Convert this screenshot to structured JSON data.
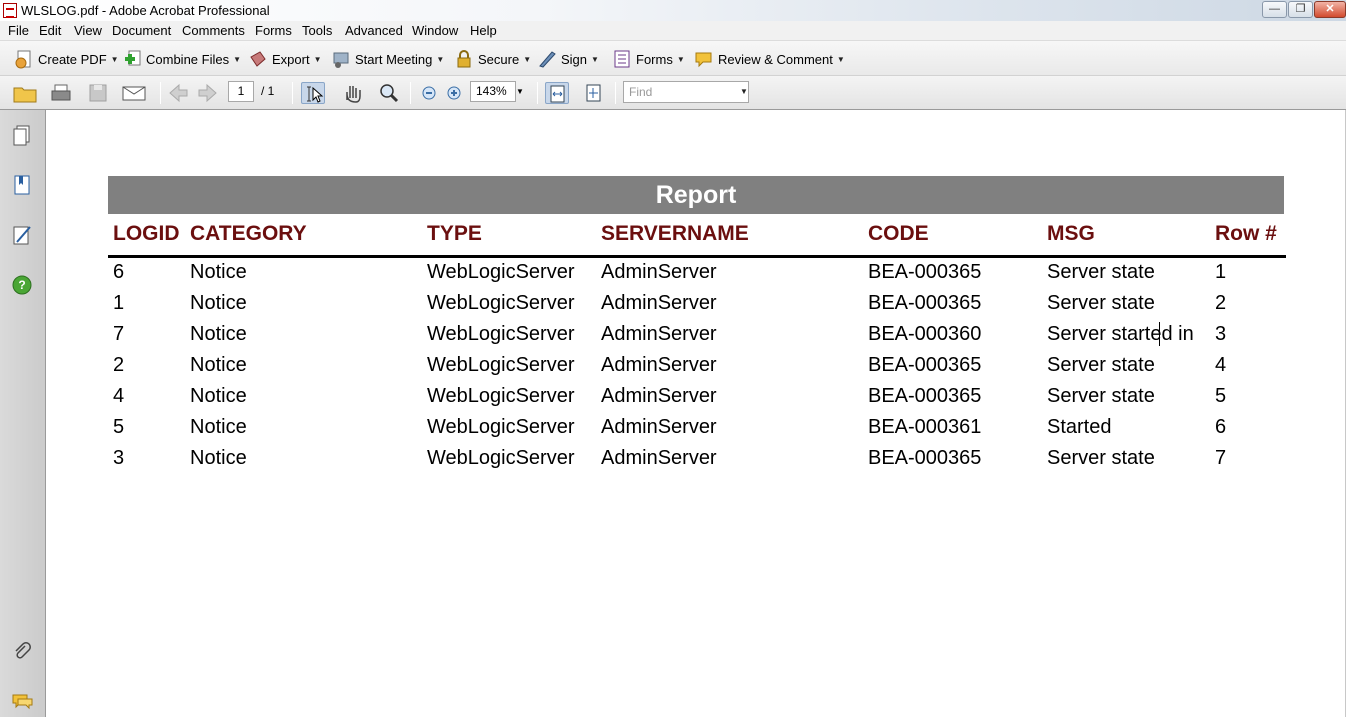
{
  "window": {
    "title": "WLSLOG.pdf - Adobe Acrobat Professional"
  },
  "menu": [
    "File",
    "Edit",
    "View",
    "Document",
    "Comments",
    "Forms",
    "Tools",
    "Advanced",
    "Window",
    "Help"
  ],
  "toolbar": {
    "create_pdf": "Create PDF",
    "combine_files": "Combine Files",
    "export": "Export",
    "start_meeting": "Start Meeting",
    "secure": "Secure",
    "sign": "Sign",
    "forms": "Forms",
    "review_comment": "Review & Comment"
  },
  "nav": {
    "page_current": "1",
    "page_total": "/ 1",
    "zoom": "143%",
    "find_placeholder": "Find"
  },
  "report": {
    "title": "Report",
    "columns": [
      "LOGID",
      "CATEGORY",
      "TYPE",
      "SERVERNAME",
      "CODE",
      "MSG",
      "Row #"
    ],
    "rows": [
      {
        "logid": "6",
        "category": "Notice",
        "type": "WebLogicServer",
        "servername": "AdminServer",
        "code": "BEA-000365",
        "msg": "Server state",
        "row": "1"
      },
      {
        "logid": "1",
        "category": "Notice",
        "type": "WebLogicServer",
        "servername": "AdminServer",
        "code": "BEA-000365",
        "msg": "Server state",
        "row": "2"
      },
      {
        "logid": "7",
        "category": "Notice",
        "type": "WebLogicServer",
        "servername": "AdminServer",
        "code": "BEA-000360",
        "msg": "Server started in",
        "row": "3"
      },
      {
        "logid": "2",
        "category": "Notice",
        "type": "WebLogicServer",
        "servername": "AdminServer",
        "code": "BEA-000365",
        "msg": "Server state",
        "row": "4"
      },
      {
        "logid": "4",
        "category": "Notice",
        "type": "WebLogicServer",
        "servername": "AdminServer",
        "code": "BEA-000365",
        "msg": "Server state",
        "row": "5"
      },
      {
        "logid": "5",
        "category": "Notice",
        "type": "WebLogicServer",
        "servername": "AdminServer",
        "code": "BEA-000361",
        "msg": "Started",
        "row": "6"
      },
      {
        "logid": "3",
        "category": "Notice",
        "type": "WebLogicServer",
        "servername": "AdminServer",
        "code": "BEA-000365",
        "msg": "Server state",
        "row": "7"
      }
    ]
  }
}
